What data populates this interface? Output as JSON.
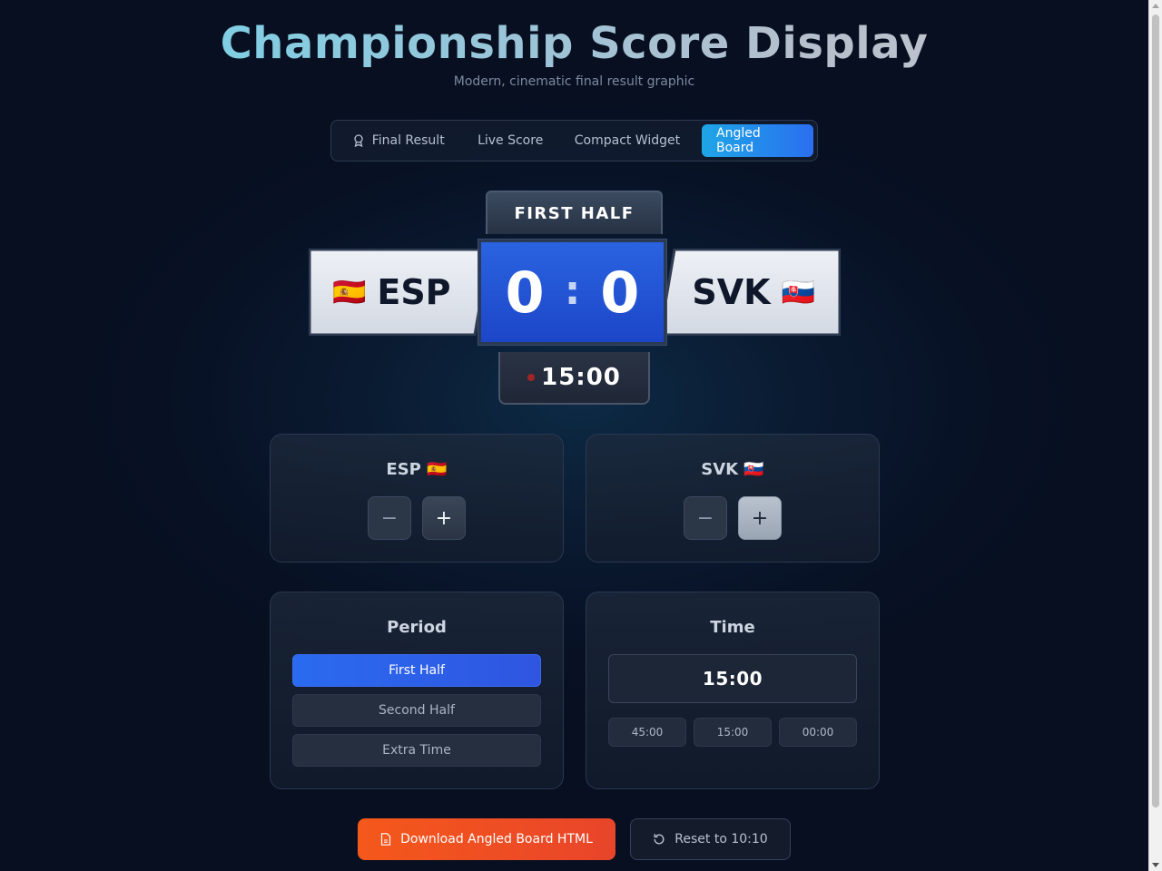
{
  "header": {
    "title": "Championship Score Display",
    "subtitle": "Modern, cinematic final result graphic"
  },
  "tabs": [
    {
      "label": "Final Result",
      "icon": "ribbon-icon"
    },
    {
      "label": "Live Score"
    },
    {
      "label": "Compact Widget"
    },
    {
      "label": "Angled Board",
      "active": true
    }
  ],
  "scoreboard": {
    "period": "FIRST HALF",
    "home": {
      "code": "ESP",
      "flag": "🇪🇸",
      "score": "0"
    },
    "away": {
      "code": "SVK",
      "flag": "🇸🇰",
      "score": "0"
    },
    "separator": ":",
    "clock": "15:00"
  },
  "controls": {
    "home_title": "ESP 🇪🇸",
    "away_title": "SVK 🇸🇰",
    "minus": "−",
    "plus": "+"
  },
  "period_panel": {
    "title": "Period",
    "options": [
      "First Half",
      "Second Half",
      "Extra Time"
    ],
    "selected": "First Half"
  },
  "time_panel": {
    "title": "Time",
    "value": "15:00",
    "presets": [
      "45:00",
      "15:00",
      "00:00"
    ]
  },
  "actions": {
    "download": "Download Angled Board HTML",
    "reset": "Reset to 10:10"
  },
  "colors": {
    "accent_blue": "#2a63e0",
    "active_tab": "#1ea6e6",
    "download_orange": "#f5581b",
    "live_dot": "#a02626"
  }
}
